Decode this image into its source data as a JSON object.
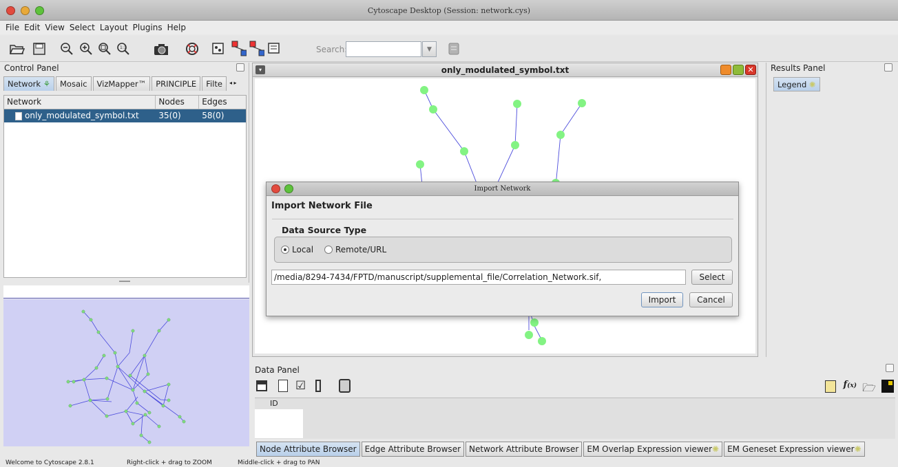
{
  "window": {
    "title": "Cytoscape Desktop (Session: network.cys)"
  },
  "menu": [
    "File",
    "Edit",
    "View",
    "Select",
    "Layout",
    "Plugins",
    "Help"
  ],
  "toolbar": {
    "search_label": "Search:",
    "search_value": ""
  },
  "control_panel": {
    "title": "Control Panel",
    "tabs": [
      "Network",
      "Mosaic",
      "VizMapper™",
      "PRINCIPLE",
      "Filte"
    ],
    "columns": [
      "Network",
      "Nodes",
      "Edges"
    ],
    "rows": [
      {
        "name": "only_modulated_symbol.txt",
        "nodes": "35(0)",
        "edges": "58(0)"
      }
    ]
  },
  "network_view": {
    "title": "only_modulated_symbol.txt"
  },
  "results_panel": {
    "title": "Results Panel",
    "tab": "Legend"
  },
  "data_panel": {
    "title": "Data Panel",
    "column_id": "ID",
    "tabs": [
      "Node Attribute Browser",
      "Edge Attribute Browser",
      "Network Attribute Browser",
      "EM Overlap Expression viewer",
      "EM Geneset Expression viewer"
    ]
  },
  "status": {
    "welcome": "Welcome to Cytoscape 2.8.1",
    "zoom_hint": "Right-click + drag to ZOOM",
    "pan_hint": "Middle-click + drag to PAN"
  },
  "dialog": {
    "title": "Import Network",
    "heading": "Import Network File",
    "group_label": "Data Source Type",
    "local_label": "Local",
    "remote_label": "Remote/URL",
    "selected_source": "Local",
    "file_path": "/media/8294-7434/FPTD/manuscript/supplemental_file/Correlation_Network.sif,",
    "select_label": "Select",
    "import_label": "Import",
    "cancel_label": "Cancel"
  },
  "colors": {
    "node": "#83f383",
    "edge": "#4b4bdc",
    "selection": "#2e608a",
    "overview_bg": "#d0d0f4"
  }
}
